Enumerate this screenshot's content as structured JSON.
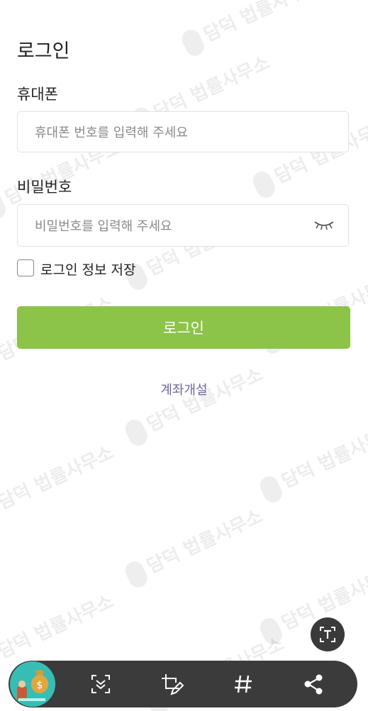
{
  "page": {
    "title": "로그인"
  },
  "phone": {
    "label": "휴대폰",
    "placeholder": "휴대폰 번호를 입력해 주세요"
  },
  "password": {
    "label": "비밀번호",
    "placeholder": "비밀번호를 입력해 주세요",
    "toggle_icon": "eye-closed-icon"
  },
  "remember": {
    "label": "로그인 정보 저장",
    "checked": false
  },
  "login_button": {
    "label": "로그인",
    "color": "#8cc349"
  },
  "open_account": {
    "label": "계좌개설"
  },
  "watermark": {
    "text": "담덕 법률사무소"
  },
  "floating": {
    "icon": "text-scan-icon"
  },
  "capture_toolbar": {
    "icons": [
      "thumbnail-avatar",
      "scroll-capture-icon",
      "crop-edit-icon",
      "hashtag-icon",
      "share-icon"
    ]
  }
}
